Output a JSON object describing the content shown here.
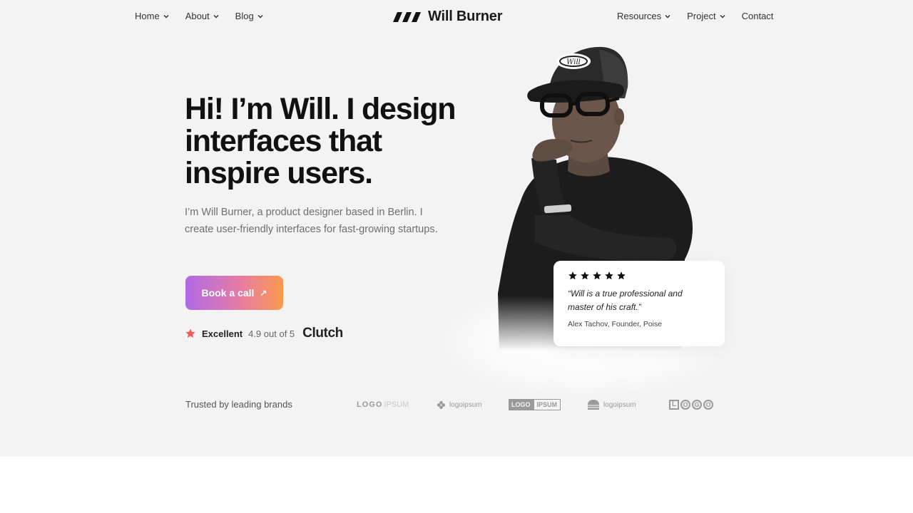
{
  "nav": {
    "left": [
      {
        "label": "Home",
        "dropdown": true
      },
      {
        "label": "About",
        "dropdown": true
      },
      {
        "label": "Blog",
        "dropdown": true
      }
    ],
    "right": [
      {
        "label": "Resources",
        "dropdown": true
      },
      {
        "label": "Project",
        "dropdown": true
      },
      {
        "label": "Contact",
        "dropdown": false
      }
    ]
  },
  "brand": {
    "name": "Will Burner",
    "logo_icon": "slashes-logo-icon"
  },
  "hero": {
    "headline": "Hi! I’m Will. I design interfaces that inspire users.",
    "subtitle": "I’m Will Burner, a product designer based in Berlin. I create user-friendly interfaces for fast-growing startups.",
    "cta_label": "Book a call",
    "cta_icon": "arrow-up-right-icon",
    "cta_gradient": [
      "#b06ae6",
      "#e57ba5",
      "#fb9a4e"
    ],
    "rating": {
      "label": "Excellent",
      "score": "4.9 out of 5",
      "platform": "Clutch",
      "star_color": "#f05a5a"
    }
  },
  "testimonial": {
    "stars": 5,
    "quote": "“Will is a true professional and master of his craft.”",
    "author": "Alex Tachov, Founder, Poise"
  },
  "trusted": {
    "label": "Trusted by leading brands",
    "logos": [
      {
        "parts": [
          "LOGO",
          "IPSUM"
        ]
      },
      {
        "parts": [
          "logoipsum"
        ]
      },
      {
        "parts": [
          "LOGO",
          "IPSUM"
        ]
      },
      {
        "parts": [
          "logoipsum"
        ]
      },
      {
        "parts": [
          "L",
          "O",
          "G",
          "O"
        ]
      }
    ]
  },
  "colors": {
    "hero_bg": "#f3f3f3",
    "text": "#111111",
    "muted": "#6f6f6f"
  }
}
